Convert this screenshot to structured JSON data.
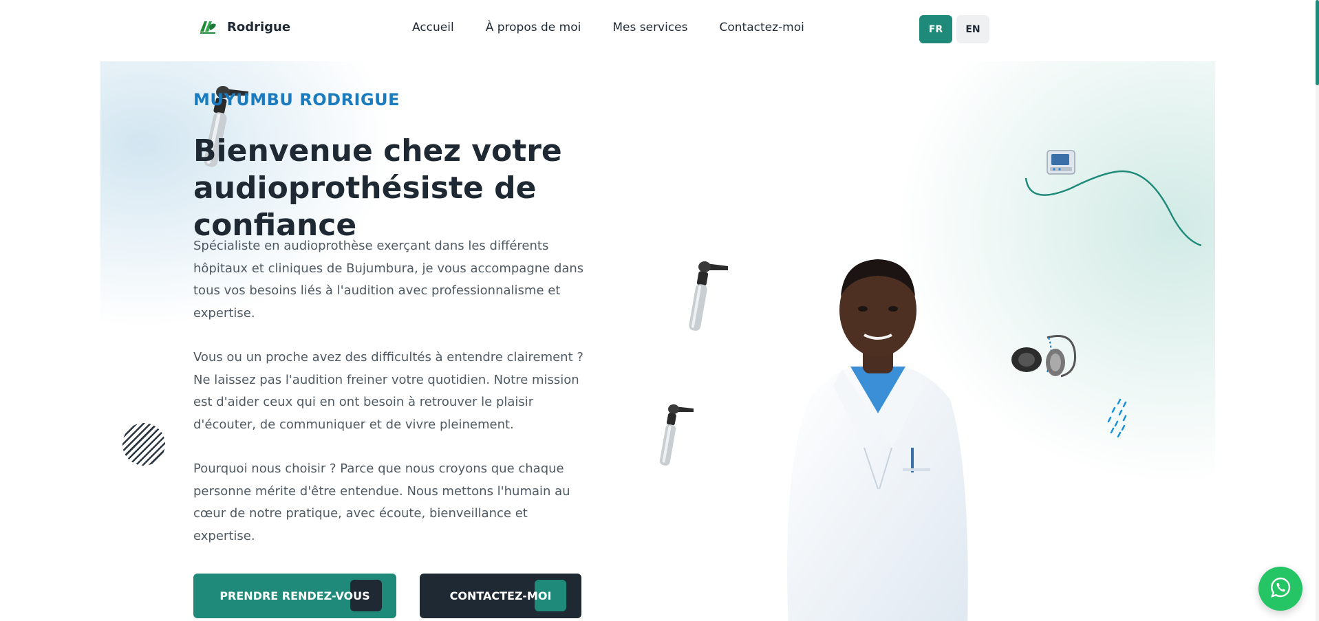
{
  "header": {
    "brand": "Rodrigue",
    "nav": [
      {
        "label": "Accueil"
      },
      {
        "label": "À propos de moi"
      },
      {
        "label": "Mes services"
      },
      {
        "label": "Contactez-moi"
      }
    ],
    "languages": {
      "fr": "FR",
      "en": "EN",
      "active": "FR"
    }
  },
  "hero": {
    "eyebrow": "MUYUMBU RODRIGUE",
    "title_line1": "Bienvenue chez votre",
    "title_line2": "audioprothésiste de confiance",
    "paragraphs": [
      "Spécialiste en audioprothèse exerçant dans les différents hôpitaux et cliniques de Bujumbura, je vous accompagne dans tous vos besoins liés à l'audition avec professionnalisme et expertise.",
      "Vous ou un proche avez des difficultés à entendre clairement ? Ne laissez pas l'audition freiner votre quotidien. Notre mission est d'aider ceux qui en ont besoin à retrouver le plaisir d'écouter, de communiquer et de vivre pleinement.",
      "Pourquoi nous choisir ? Parce que nous croyons que chaque personne mérite d'être entendue. Nous mettons l'humain au cœur de notre pratique, avec écoute, bienveillance et expertise."
    ],
    "buttons": {
      "primary": "PRENDRE RENDEZ-VOUS",
      "secondary": "CONTACTEZ-MOI"
    }
  },
  "icons": [
    "logo-mark-icon",
    "otoscope-icon",
    "audiometer-icon",
    "headphones-icon",
    "dots-icon",
    "whatsapp-icon"
  ],
  "colors": {
    "accent": "#1f8a7a",
    "eyebrow": "#1a7bbf",
    "dark": "#1f2933",
    "whatsapp": "#25c464"
  }
}
